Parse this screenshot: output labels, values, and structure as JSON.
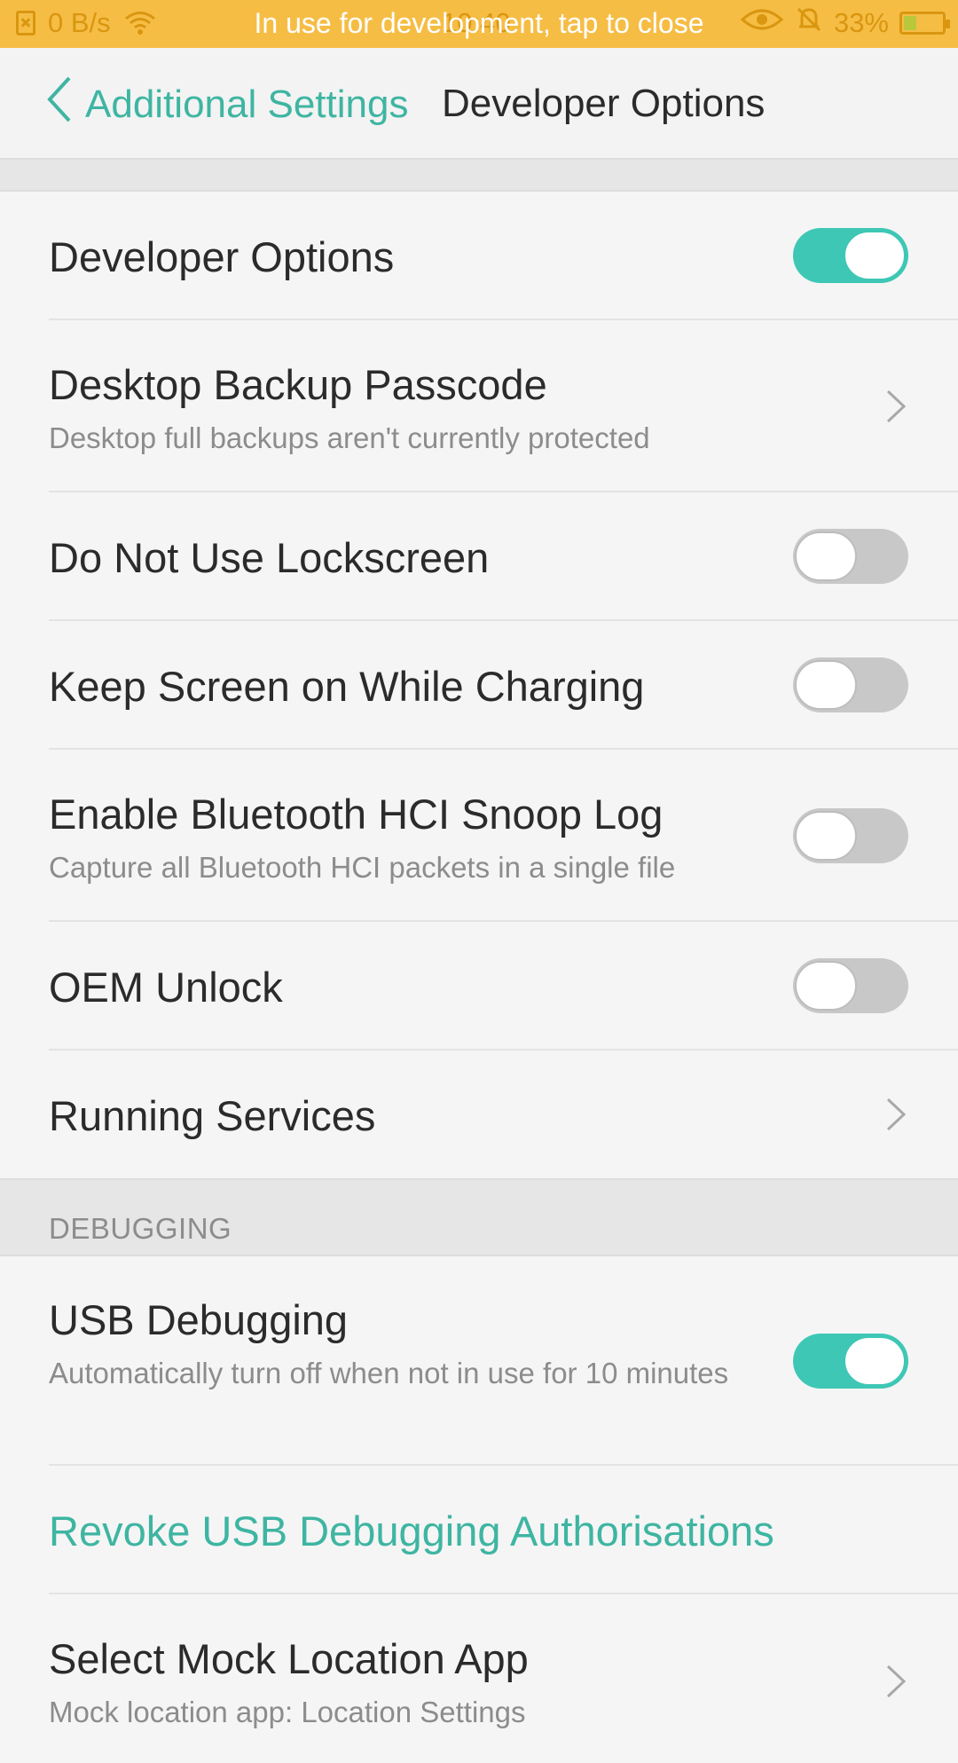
{
  "status_bar": {
    "net_speed": "0 B/s",
    "time": "10:40",
    "banner": "In use for development, tap to close",
    "battery_percent": "33%",
    "battery_level": 0.33
  },
  "header": {
    "back_label": "Additional Settings",
    "title": "Developer Options"
  },
  "rows": [
    {
      "title": "Developer Options",
      "control": "toggle",
      "on": true
    },
    {
      "title": "Desktop Backup Passcode",
      "subtitle": "Desktop full backups aren't currently protected",
      "control": "chevron"
    },
    {
      "title": "Do Not Use Lockscreen",
      "control": "toggle",
      "on": false
    },
    {
      "title": "Keep Screen on While Charging",
      "control": "toggle",
      "on": false
    },
    {
      "title": "Enable Bluetooth HCI Snoop Log",
      "subtitle": "Capture all Bluetooth HCI packets in a single file",
      "control": "toggle",
      "on": false
    },
    {
      "title": "OEM Unlock",
      "control": "toggle",
      "on": false
    },
    {
      "title": "Running Services",
      "control": "chevron"
    }
  ],
  "debugging": {
    "section_label": "DEBUGGING",
    "rows": [
      {
        "title": "USB Debugging",
        "subtitle": "Automatically turn off when not in use for 10 minutes",
        "control": "toggle",
        "on": true
      },
      {
        "title": "Revoke USB Debugging Authorisations",
        "control": "link"
      },
      {
        "title": "Select Mock Location App",
        "subtitle": "Mock location app: Location Settings",
        "control": "chevron"
      }
    ]
  },
  "colors": {
    "accent": "#3eb5a2",
    "toggle_on": "#3ec7b5",
    "status_bar": "#f6bd45"
  }
}
